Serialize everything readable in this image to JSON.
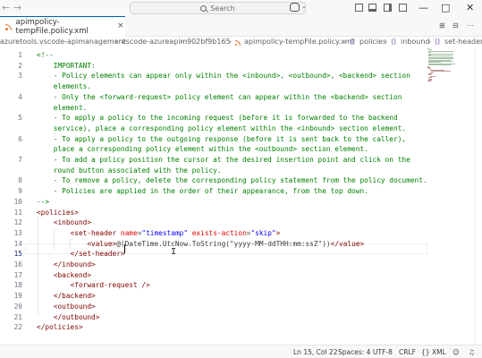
{
  "titlebar": {
    "back_arrow": "←",
    "forward_arrow": "→",
    "search_label": "Search",
    "icons": [
      "copilot-icon",
      "toggle-primary-sidebar-icon",
      "toggle-panel-icon",
      "toggle-secondary-sidebar-icon",
      "customize-layout-icon"
    ],
    "minimize": "—",
    "maximize": "□",
    "close": "✕"
  },
  "tab": {
    "label": "apimpolicy-tempFile.policy.xml",
    "close": "×",
    "actions": [
      "⊞",
      "⊟",
      "⋯"
    ]
  },
  "breadcrumb": {
    "segments": [
      "-azuretools.vscode-apimanagement",
      "vscode-azureapim",
      "902bf9b165",
      "apimpolicy-tempFile.policy.xml",
      "policies",
      "inbound",
      "set-header"
    ],
    "separator": "›"
  },
  "editor": {
    "active_line": 15,
    "lines": [
      {
        "n": "1",
        "text": "<!--"
      },
      {
        "n": "2",
        "text": "    IMPORTANT:"
      },
      {
        "n": "3",
        "text": "    - Policy elements can appear only within the <inbound>, <outbound>, <backend> section"
      },
      {
        "n": "",
        "text": "    elements."
      },
      {
        "n": "4",
        "text": "    - Only the <forward-request> policy element can appear within the <backend> section"
      },
      {
        "n": "",
        "text": "    element."
      },
      {
        "n": "5",
        "text": "    - To apply a policy to the incoming request (before it is forwarded to the backend"
      },
      {
        "n": "",
        "text": "    service), place a corresponding policy element within the <inbound> section element."
      },
      {
        "n": "6",
        "text": "    - To apply a policy to the outgoing response (before it is sent back to the caller),"
      },
      {
        "n": "",
        "text": "    place a corresponding policy element within the <outbound> section element."
      },
      {
        "n": "7",
        "text": "    - To add a policy position the cursor at the desired insertion point and click on the"
      },
      {
        "n": "",
        "text": "    round button associated with the policy."
      },
      {
        "n": "8",
        "text": "    - To remove a policy, delete the corresponding policy statement from the policy document."
      },
      {
        "n": "9",
        "text": "    - Policies are applied in the order of their appearance, from the top down."
      },
      {
        "n": "10",
        "text": "-->"
      },
      {
        "n": "11",
        "text": "<policies>"
      },
      {
        "n": "12",
        "text": "    <inbound>"
      },
      {
        "n": "13",
        "text": "        <set-header name=\"timestamp\" exists-action=\"skip\">"
      },
      {
        "n": "14",
        "text": "            <value>@(DateTime.UtcNow.ToString(\"yyyy-MM-ddTHH:mm:ssZ\"))</value>"
      },
      {
        "n": "15",
        "text": "        </set-header>"
      },
      {
        "n": "16",
        "text": "    </inbound>"
      },
      {
        "n": "17",
        "text": "    <backend>"
      },
      {
        "n": "18",
        "text": "        <forward-request />"
      },
      {
        "n": "19",
        "text": "    </backend>"
      },
      {
        "n": "20",
        "text": "    <outbound>"
      },
      {
        "n": "21",
        "text": "    </outbound>"
      },
      {
        "n": "22",
        "text": "</policies>"
      }
    ]
  },
  "statusbar": {
    "position": "Ln 15, Col 22",
    "spaces": "Spaces: 4",
    "encoding": "UTF-8",
    "eol": "CRLF",
    "language_icon": "{}",
    "language": "XML",
    "notifications_icon": "bell-icon"
  },
  "colors": {
    "comment": "#008000",
    "tag": "#800000",
    "attribute": "#e50000",
    "string": "#0000ff",
    "accent": "#005fb8"
  }
}
